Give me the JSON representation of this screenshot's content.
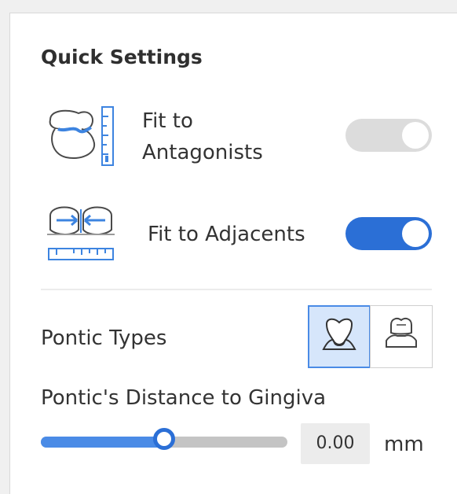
{
  "panel": {
    "title": "Quick Settings",
    "fit_antagonists": {
      "label_line1": "Fit to",
      "label_line2": "Antagonists",
      "icon": "antagonist-tooth-icon",
      "enabled": false,
      "toggle_on": true
    },
    "fit_adjacents": {
      "label": "Fit to Adjacents",
      "icon": "adjacent-teeth-icon",
      "enabled": true,
      "toggle_on": true
    },
    "pontic_types": {
      "label": "Pontic Types",
      "options": [
        {
          "icon": "pontic-saddle-icon",
          "selected": true
        },
        {
          "icon": "pontic-modified-icon",
          "selected": false
        }
      ]
    },
    "gingiva_distance": {
      "label": "Pontic's Distance to Gingiva",
      "value": "0.00",
      "unit": "mm",
      "slider_fraction": 0.5
    }
  },
  "colors": {
    "accent": "#2b6fd6",
    "accent_light": "#4a8be6",
    "selected_bg": "#d6e6fb",
    "toggle_disabled": "#dcdcdc"
  }
}
